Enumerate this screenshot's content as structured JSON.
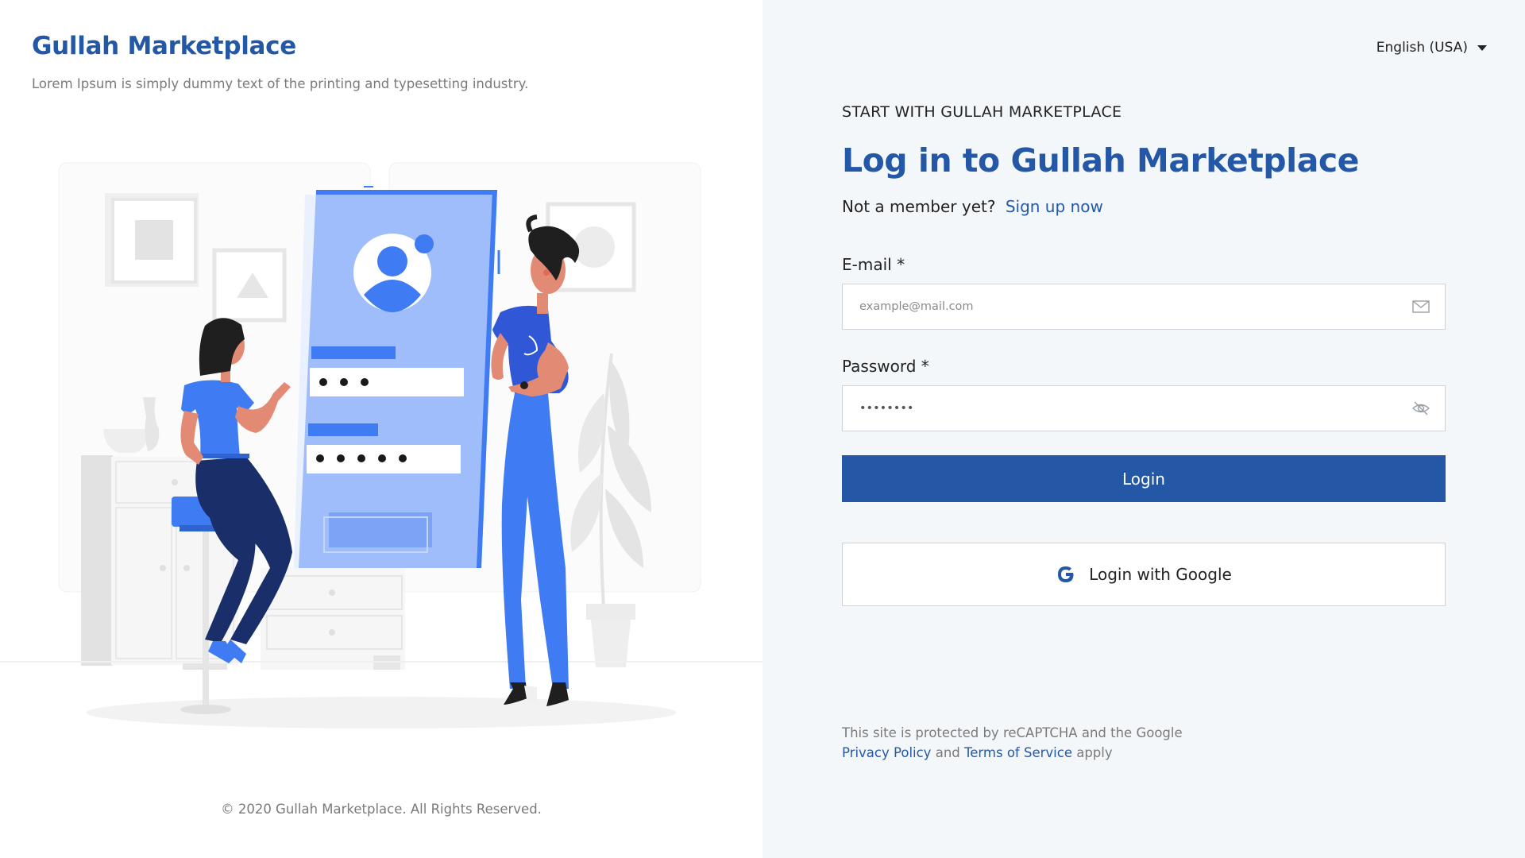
{
  "brand": {
    "title": "Gullah Marketplace",
    "tagline": "Lorem Ipsum is simply dummy text of the printing and typesetting industry."
  },
  "footer": {
    "copyright": "© 2020 Gullah Marketplace. All Rights Reserved."
  },
  "language": {
    "selected": "English (USA)"
  },
  "login": {
    "eyebrow": "START WITH GULLAH MARKETPLACE",
    "title": "Log in to Gullah Marketplace",
    "member_prompt": "Not a member yet?",
    "signup_link": "Sign up now",
    "email_label": "E-mail *",
    "email_placeholder": "example@mail.com",
    "password_label": "Password *",
    "password_value": "••••••••",
    "login_button": "Login",
    "google_button": "Login with Google"
  },
  "legal": {
    "line1": "This site is protected by reCAPTCHA and the Google",
    "privacy_link": "Privacy Policy",
    "and": "and",
    "terms_link": "Terms of Service",
    "apply": "apply"
  },
  "colors": {
    "accent": "#2458a6",
    "illustration_blue": "#3f7cf4",
    "illustration_light_blue": "#9ebdfa",
    "illustration_navy": "#1a2e6a",
    "panel_background": "#f4f7fa"
  },
  "icons": [
    "mail-icon",
    "eye-slash-icon",
    "google-icon",
    "caret-down-icon"
  ]
}
